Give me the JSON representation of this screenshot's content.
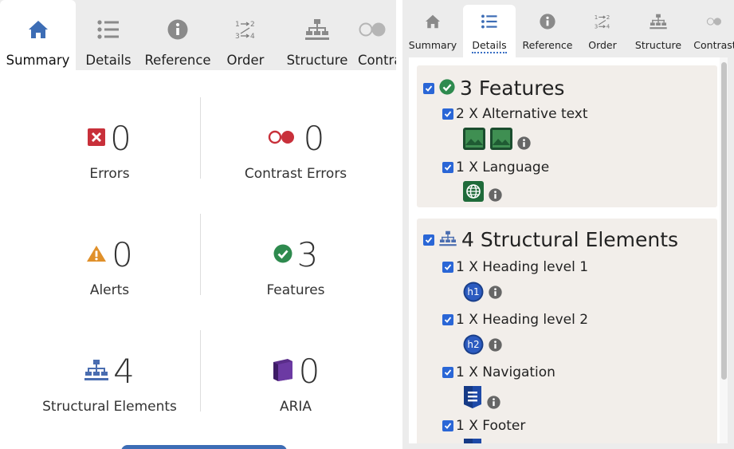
{
  "left": {
    "tabs": [
      {
        "label": "Summary",
        "icon": "home-icon"
      },
      {
        "label": "Details",
        "icon": "list-icon"
      },
      {
        "label": "Reference",
        "icon": "info-icon"
      },
      {
        "label": "Order",
        "icon": "order-icon"
      },
      {
        "label": "Structure",
        "icon": "structure-icon"
      },
      {
        "label": "Contra",
        "icon": "contrast-icon"
      }
    ],
    "stats": {
      "errors": {
        "count": "0",
        "label": "Errors",
        "icon": "error-x-icon"
      },
      "contrast_errors": {
        "count": "0",
        "label": "Contrast Errors",
        "icon": "contrast-icon"
      },
      "alerts": {
        "count": "0",
        "label": "Alerts",
        "icon": "alert-triangle-icon"
      },
      "features": {
        "count": "3",
        "label": "Features",
        "icon": "check-circle-icon"
      },
      "structural": {
        "count": "4",
        "label": "Structural Elements",
        "icon": "structure-icon"
      },
      "aria": {
        "count": "0",
        "label": "ARIA",
        "icon": "aria-cube-icon"
      }
    }
  },
  "right": {
    "tabs": [
      {
        "label": "Summary",
        "icon": "home-icon"
      },
      {
        "label": "Details",
        "icon": "list-icon"
      },
      {
        "label": "Reference",
        "icon": "info-icon"
      },
      {
        "label": "Order",
        "icon": "order-icon"
      },
      {
        "label": "Structure",
        "icon": "structure-icon"
      },
      {
        "label": "Contrast",
        "icon": "contrast-icon"
      }
    ],
    "features": {
      "title": "3 Features",
      "items": [
        {
          "label": "2 X Alternative text"
        },
        {
          "label": "1 X Language"
        }
      ]
    },
    "structural": {
      "title": "4 Structural Elements",
      "items": [
        {
          "label": "1 X Heading level 1",
          "badge": "h1"
        },
        {
          "label": "1 X Heading level 2",
          "badge": "h2"
        },
        {
          "label": "1 X Navigation"
        },
        {
          "label": "1 X Footer"
        }
      ]
    }
  },
  "colors": {
    "accent": "#3a6fc4",
    "error": "#c8303a",
    "alert": "#e0902a",
    "feature": "#2e8a4e",
    "structure": "#4a6db0",
    "aria": "#5a2d8a",
    "checkbox": "#2a66d6"
  }
}
